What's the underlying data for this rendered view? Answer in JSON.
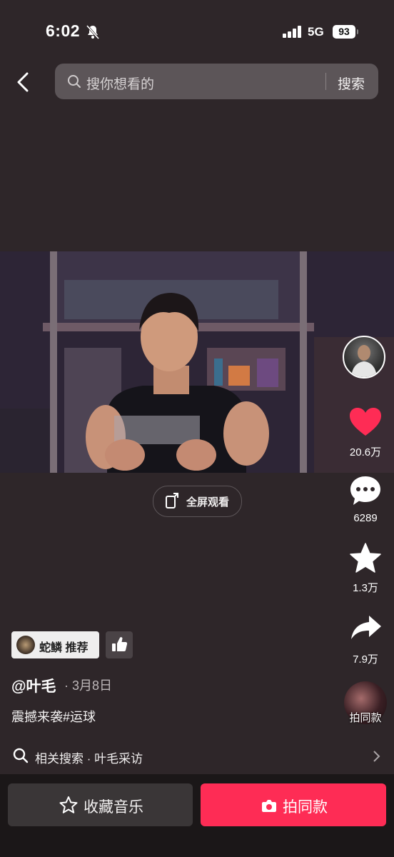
{
  "status_bar": {
    "time": "6:02",
    "network": "5G",
    "battery": "93"
  },
  "search": {
    "placeholder": "搜你想看的",
    "button_label": "搜索"
  },
  "video": {
    "fullscreen_label": "全屏观看"
  },
  "actions": {
    "likes": "20.6万",
    "comments": "6289",
    "favorites": "1.3万",
    "shares": "7.9万",
    "music_label": "拍同款"
  },
  "post": {
    "recommender_label": "蛇鳞 推荐",
    "author": "@叶毛",
    "date": "· 3月8日",
    "caption": "震撼来袭#运球",
    "related_search": "相关搜索 · 叶毛采访"
  },
  "bottom": {
    "favorite_music_label": "收藏音乐",
    "shoot_same_label": "拍同款"
  },
  "colors": {
    "accent": "#fe2c55",
    "like": "#fe2c55",
    "background": "#2e2629"
  },
  "icons": [
    "bell-muted-icon",
    "signal-icon",
    "battery-icon",
    "back-icon",
    "search-icon",
    "fullscreen-icon",
    "heart-icon",
    "comment-icon",
    "star-icon",
    "share-icon",
    "thumbs-up-icon",
    "chevron-right-icon",
    "camera-icon"
  ]
}
